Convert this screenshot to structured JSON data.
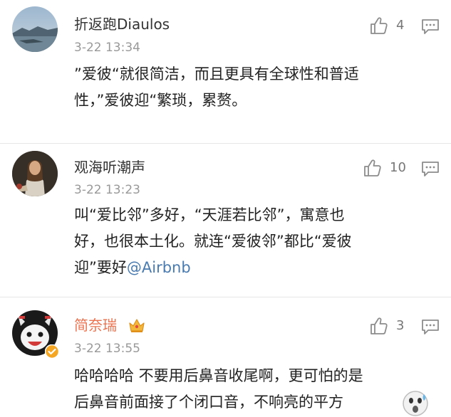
{
  "comments": [
    {
      "username": "折返跑Diaulos",
      "timestamp": "3-22 13:34",
      "likes": "4",
      "body_lines": [
        "”爱彼“就很简洁，而且更具有全球性和普适",
        "性，”爱彼迎“繁琐，累赘。"
      ]
    },
    {
      "username": "观海听潮声",
      "timestamp": "3-22 13:23",
      "likes": "10",
      "body_lines": [
        "叫“爱比邻”多好，“天涯若比邻”，寓意也",
        "好，也很本土化。就连“爱彼邻”都比“爱彼",
        "迎”要好"
      ],
      "mention": "@Airbnb"
    },
    {
      "username": "简奈瑞",
      "timestamp": "3-22 13:55",
      "likes": "3",
      "body_lines": [
        "哈哈哈哈 不要用后鼻音收尾啊，更可怕的是",
        "后鼻音前面接了个闭口音，不响亮的平方"
      ]
    }
  ],
  "colors": {
    "username": "#333333",
    "vip_username": "#eb7350",
    "timestamp": "#999999",
    "mention": "#4a7bb0",
    "icon": "#8c8c8c"
  },
  "icons": {
    "like": "thumbs-up-icon",
    "reply": "speech-bubble-icon",
    "vip": "crown-icon",
    "verified": "verified-badge-icon",
    "emoji": "surprised-face-icon"
  }
}
